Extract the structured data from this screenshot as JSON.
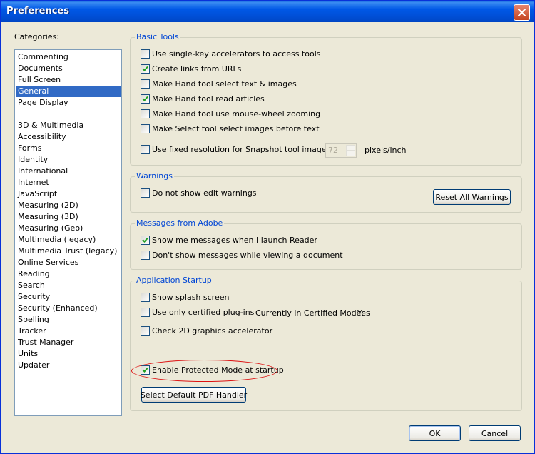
{
  "window": {
    "title": "Preferences"
  },
  "categories": {
    "label": "Categories:",
    "items": [
      "Commenting",
      "Documents",
      "Full Screen",
      "General",
      "Page Display"
    ],
    "items2": [
      "3D & Multimedia",
      "Accessibility",
      "Forms",
      "Identity",
      "International",
      "Internet",
      "JavaScript",
      "Measuring (2D)",
      "Measuring (3D)",
      "Measuring (Geo)",
      "Multimedia (legacy)",
      "Multimedia Trust (legacy)",
      "Online Services",
      "Reading",
      "Search",
      "Security",
      "Security (Enhanced)",
      "Spelling",
      "Tracker",
      "Trust Manager",
      "Units",
      "Updater"
    ],
    "selected": "General"
  },
  "basic_tools": {
    "label": "Basic Tools",
    "options": [
      {
        "label": "Use single-key accelerators to access tools",
        "checked": false
      },
      {
        "label": "Create links from URLs",
        "checked": true
      },
      {
        "label": "Make Hand tool select text & images",
        "checked": false
      },
      {
        "label": "Make Hand tool read articles",
        "checked": true
      },
      {
        "label": "Make Hand tool use mouse-wheel zooming",
        "checked": false
      },
      {
        "label": "Make Select tool select images before text",
        "checked": false
      },
      {
        "label": "Use fixed resolution for Snapshot tool images:",
        "checked": false
      }
    ],
    "resolution_value": "72",
    "resolution_unit": "pixels/inch"
  },
  "warnings": {
    "label": "Warnings",
    "option": {
      "label": "Do not show edit warnings",
      "checked": false
    },
    "reset_button": "Reset All Warnings"
  },
  "messages": {
    "label": "Messages from Adobe",
    "options": [
      {
        "label": "Show me messages when I launch Reader",
        "checked": true
      },
      {
        "label": "Don't show messages while viewing a document",
        "checked": false
      }
    ]
  },
  "startup": {
    "label": "Application Startup",
    "options": [
      {
        "label": "Show splash screen",
        "checked": false
      },
      {
        "label": "Use only certified plug-ins",
        "checked": false
      },
      {
        "label": "Check 2D graphics accelerator",
        "checked": false
      },
      {
        "label": "Enable Protected Mode at startup",
        "checked": true
      }
    ],
    "certified_mode_label": "Currently in Certified Mode:",
    "certified_mode_value": "Yes",
    "default_pdf_button": "Select Default PDF Handler"
  },
  "footer": {
    "ok": "OK",
    "cancel": "Cancel"
  },
  "colors": {
    "title_bar": "#0058e6",
    "selection": "#316ac5",
    "group_label": "#0046d5",
    "highlight_ellipse": "#dd1111"
  }
}
